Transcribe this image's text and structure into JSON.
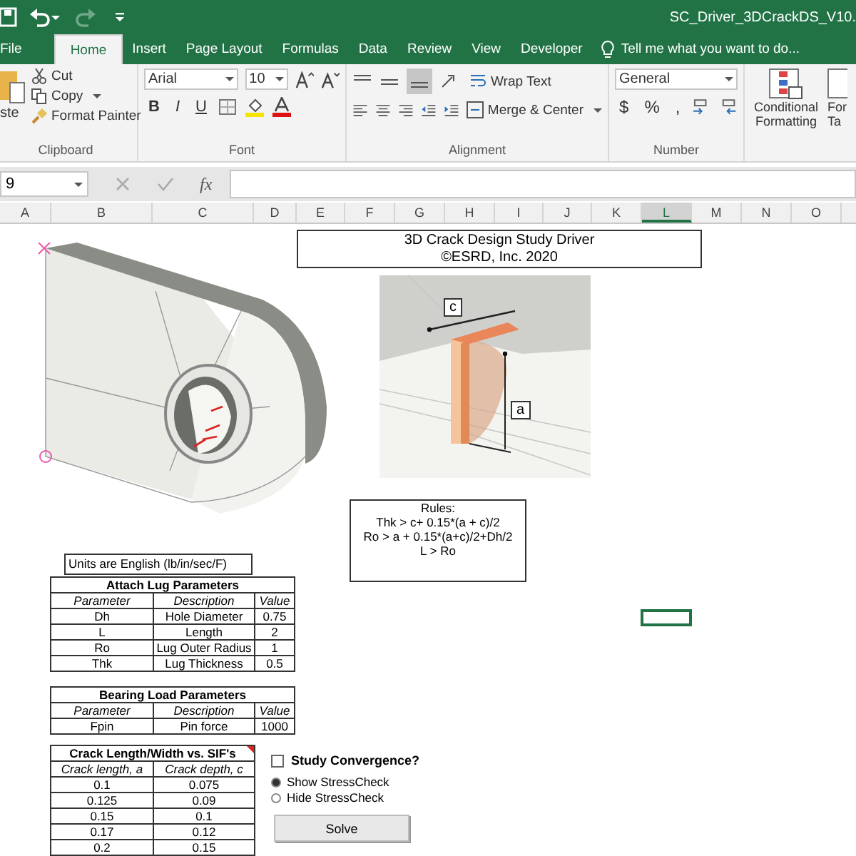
{
  "window": {
    "title": "SC_Driver_3DCrackDS_V10."
  },
  "tabs": [
    {
      "label": "File",
      "selected": false
    },
    {
      "label": "Home",
      "selected": true
    },
    {
      "label": "Insert",
      "selected": false
    },
    {
      "label": "Page Layout",
      "selected": false
    },
    {
      "label": "Formulas",
      "selected": false
    },
    {
      "label": "Data",
      "selected": false
    },
    {
      "label": "Review",
      "selected": false
    },
    {
      "label": "View",
      "selected": false
    },
    {
      "label": "Developer",
      "selected": false
    }
  ],
  "tell_me": {
    "placeholder": "Tell me what you want to do..."
  },
  "clipboard": {
    "paste": "ste",
    "cut": "Cut",
    "copy": "Copy",
    "format_painter": "Format Painter",
    "label": "Clipboard"
  },
  "font": {
    "name": "Arial",
    "size": "10",
    "bold": "B",
    "italic": "I",
    "underline": "U",
    "label": "Font"
  },
  "alignment": {
    "wrap_text": "Wrap Text",
    "merge_center": "Merge & Center",
    "label": "Alignment"
  },
  "number": {
    "format": "General",
    "currency": "$",
    "percent": "%",
    "comma": ",",
    "label": "Number"
  },
  "styles": {
    "conditional_formatting": [
      "Conditional",
      "Formatting"
    ],
    "next_button": [
      "For",
      "Ta"
    ]
  },
  "formula_bar": {
    "name_box": "9",
    "fx": "fx"
  },
  "columns": [
    {
      "label": "A",
      "selected": false
    },
    {
      "label": "B",
      "selected": false
    },
    {
      "label": "C",
      "selected": false
    },
    {
      "label": "D",
      "selected": false
    },
    {
      "label": "E",
      "selected": false
    },
    {
      "label": "F",
      "selected": false
    },
    {
      "label": "G",
      "selected": false
    },
    {
      "label": "H",
      "selected": false
    },
    {
      "label": "I",
      "selected": false
    },
    {
      "label": "J",
      "selected": false
    },
    {
      "label": "K",
      "selected": false
    },
    {
      "label": "L",
      "selected": true
    },
    {
      "label": "M",
      "selected": false
    },
    {
      "label": "N",
      "selected": false
    },
    {
      "label": "O",
      "selected": false
    }
  ],
  "sheet": {
    "title_box": [
      "3D Crack Design Study Driver",
      "©ESRD, Inc. 2020"
    ],
    "crack_figure": {
      "labels": [
        "c",
        "a"
      ]
    },
    "rules_box": [
      "Rules:",
      "Thk > c+ 0.15*(a + c)/2",
      "Ro > a + 0.15*(a+c)/2+Dh/2",
      "L > Ro"
    ],
    "units": "Units are English (lb/in/sec/F)",
    "tables": [
      {
        "title": "Attach Lug Parameters",
        "columns": [
          "Parameter",
          "Description",
          "Value"
        ],
        "rows": [
          [
            "Dh",
            "Hole Diameter",
            "0.75"
          ],
          [
            "L",
            "Length",
            "2"
          ],
          [
            "Ro",
            "Lug Outer Radius",
            "1"
          ],
          [
            "Thk",
            "Lug Thickness",
            "0.5"
          ]
        ]
      },
      {
        "title": "Bearing Load Parameters",
        "columns": [
          "Parameter",
          "Description",
          "Value"
        ],
        "rows": [
          [
            "Fpin",
            "Pin force",
            "1000"
          ]
        ]
      },
      {
        "title": "Crack Length/Width vs. SIF's",
        "columns": [
          "Crack length, a",
          "Crack depth, c"
        ],
        "rows": [
          [
            "0.1",
            "0.075"
          ],
          [
            "0.125",
            "0.09"
          ],
          [
            "0.15",
            "0.1"
          ],
          [
            "0.17",
            "0.12"
          ],
          [
            "0.2",
            "0.15"
          ]
        ]
      }
    ],
    "study_convergence": {
      "label": "Study Convergence?",
      "checked": false
    },
    "display_options": [
      {
        "label": "Show StressCheck",
        "selected": true
      },
      {
        "label": "Hide StressCheck",
        "selected": false
      }
    ],
    "solve_button": "Solve"
  }
}
